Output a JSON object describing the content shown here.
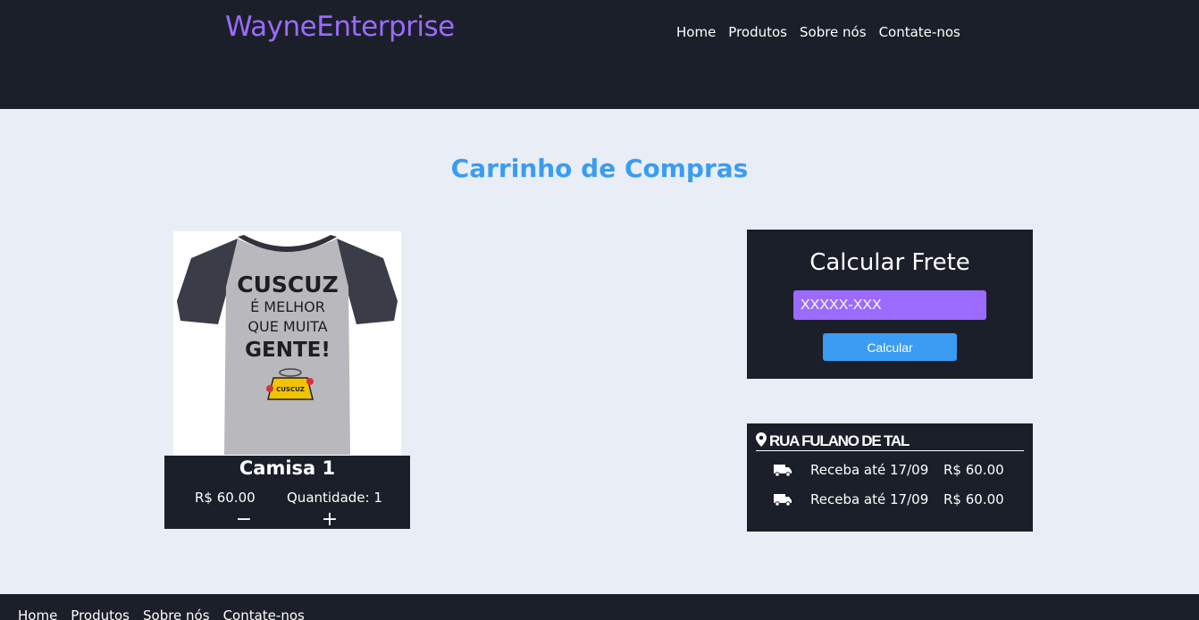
{
  "header": {
    "brand": "WayneEnterprise",
    "nav": [
      "Home",
      "Produtos",
      "Sobre nós",
      "Contate-nos"
    ]
  },
  "page": {
    "title": "Carrinho de Compras"
  },
  "cart_item": {
    "image_text": [
      "CUSCUZ",
      "É MELHOR",
      "QUE MUITA",
      "GENTE!"
    ],
    "image_badge": "CUSCUZ",
    "name": "Camisa 1",
    "price": "R$ 60.00",
    "quantity": "Quantidade: 1",
    "decrement": "−",
    "increment": "+"
  },
  "shipping_calc": {
    "title": "Calcular Frete",
    "placeholder": "XXXXX-XXX",
    "button": "Calcular"
  },
  "address": {
    "icon": "map-pin-icon",
    "street": "RUA FULANO DE TAL",
    "options": [
      {
        "icon": "truck-icon",
        "date": "Receba até 17/09",
        "price": "R$ 60.00"
      },
      {
        "icon": "truck-icon",
        "date": "Receba até 17/09",
        "price": "R$ 60.00"
      }
    ]
  },
  "footer": {
    "nav": [
      "Home",
      "Produtos",
      "Sobre nós",
      "Contate-nos"
    ]
  },
  "colors": {
    "dark": "#1b1f29",
    "accent_purple": "#9b6bff",
    "accent_blue": "#3a9cf2",
    "background": "#e9eef6"
  }
}
